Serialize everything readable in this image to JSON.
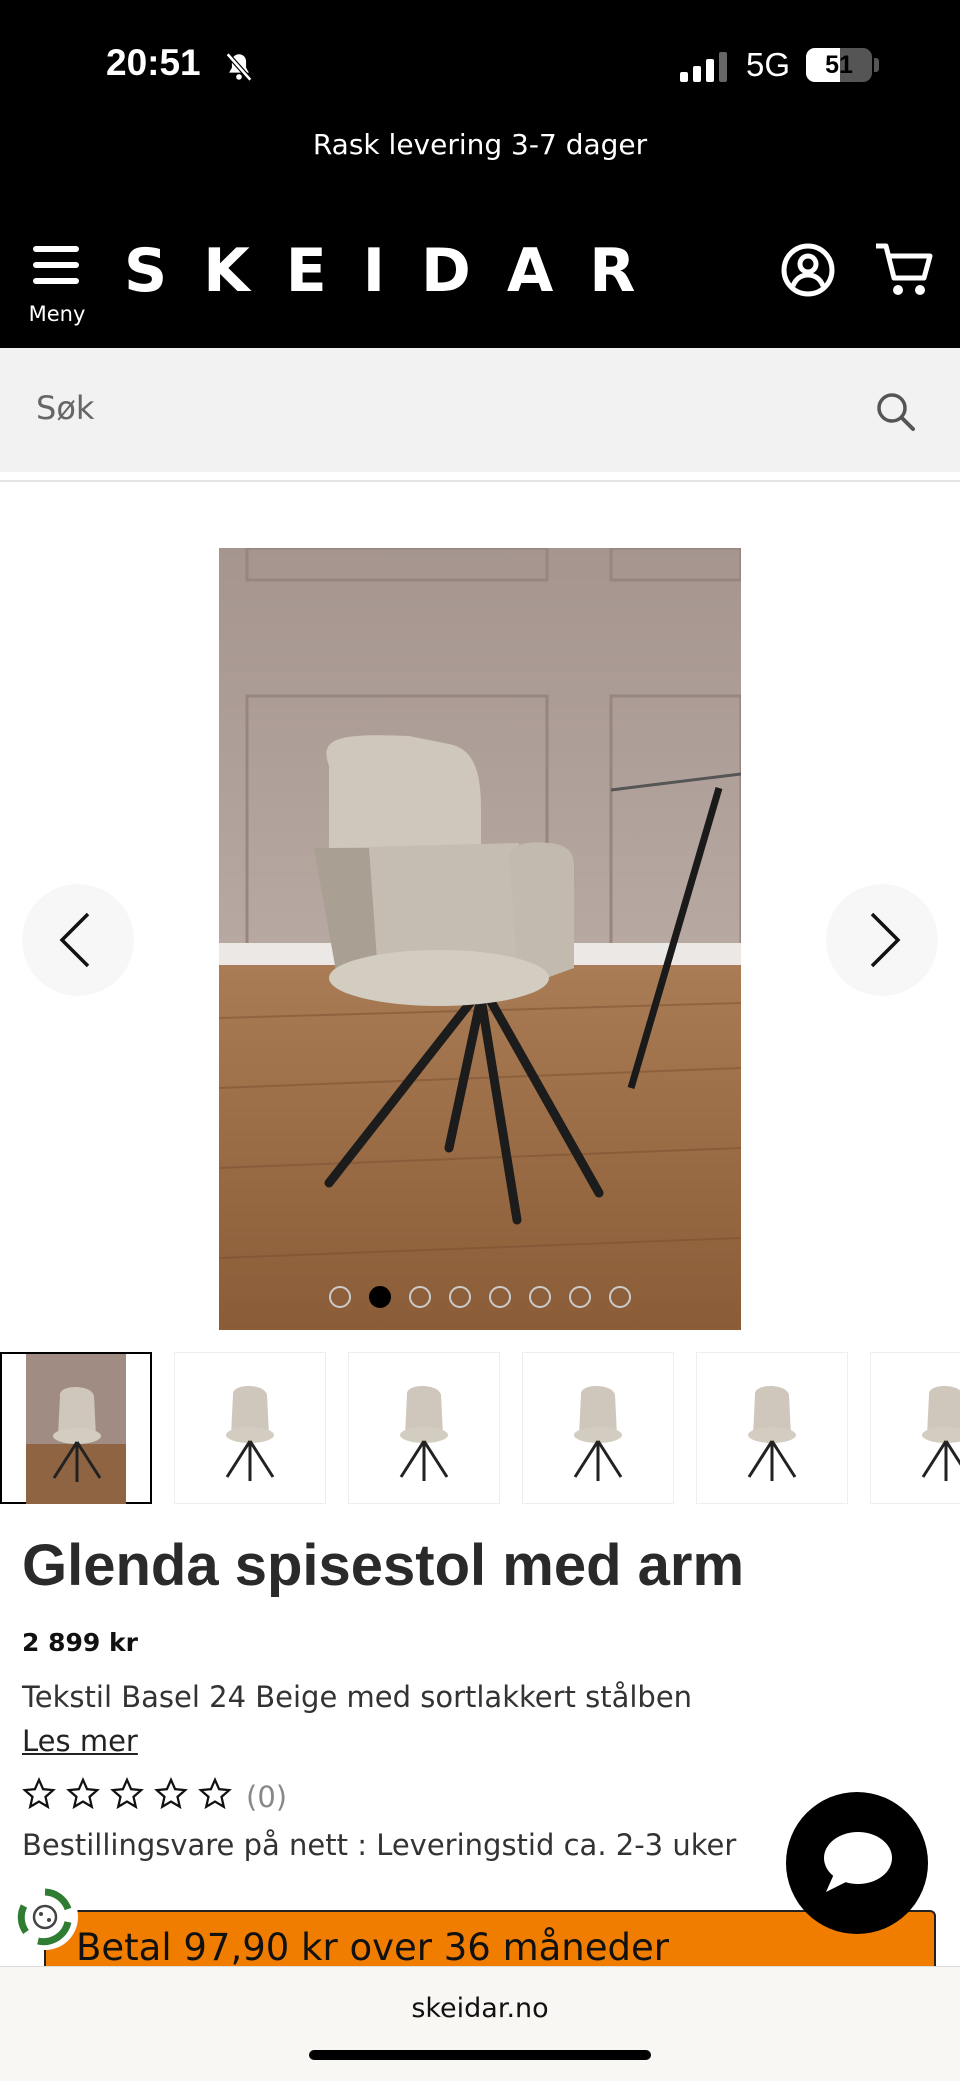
{
  "status_bar": {
    "time": "20:51",
    "network": "5G",
    "battery": "51"
  },
  "promo_text": "Rask levering 3-7 dager",
  "header": {
    "brand": "SKEIDAR",
    "menu_label": "Meny"
  },
  "search": {
    "placeholder": "Søk"
  },
  "gallery": {
    "image_count": 8,
    "active_index": 1,
    "thumbnail_count": 6,
    "selected_thumbnail": 0
  },
  "product": {
    "title": "Glenda spisestol med arm",
    "price": "2 899 kr",
    "description": "Tekstil Basel 24 Beige med sortlakkert stålben",
    "read_more": "Les mer",
    "rating_stars": 0,
    "rating_count": "(0)",
    "delivery": "Bestillingsvare på nett : Leveringstid ca. 2-3 uker",
    "finance_text": "Betal 97,90 kr over 36 måneder"
  },
  "browser": {
    "url": "skeidar.no"
  },
  "colors": {
    "header_bg": "#000000",
    "finance_bg": "#f07d00",
    "search_bg": "#f2f2f2"
  }
}
